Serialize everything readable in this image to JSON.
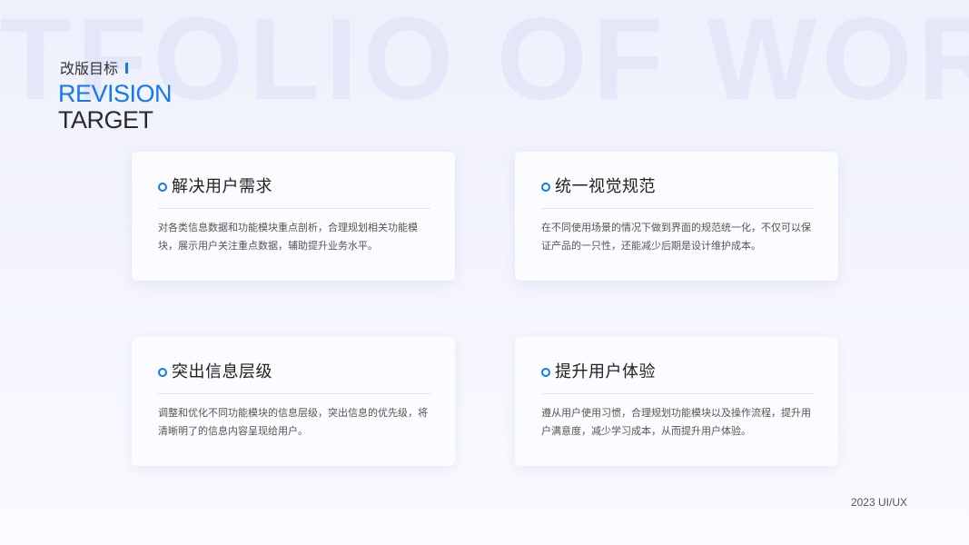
{
  "watermark": "TFOLIO OF WORK",
  "header": {
    "zh_title": "改版目标",
    "en_line1": "REVISION",
    "en_line2": "TARGET"
  },
  "cards": [
    {
      "title": "解决用户需求",
      "desc": "对各类信息数据和功能模块重点剖析，合理规划相关功能模块，展示用户关注重点数据，辅助提升业务水平。"
    },
    {
      "title": "统一视觉规范",
      "desc": "在不同使用场景的情况下做到界面的规范统一化，不仅可以保证产品的一只性，还能减少后期是设计维护成本。"
    },
    {
      "title": "突出信息层级",
      "desc": "调整和优化不同功能模块的信息层级，突出信息的优先级，将清晰明了的信息内容呈现给用户。"
    },
    {
      "title": "提升用户体验",
      "desc": "遵从用户使用习惯，合理规划功能模块以及操作流程，提升用户满意度，减少学习成本，从而提升用户体验。"
    }
  ],
  "footer": "2023 UI/UX",
  "colors": {
    "accent": "#1479f0",
    "text": "#222222"
  }
}
